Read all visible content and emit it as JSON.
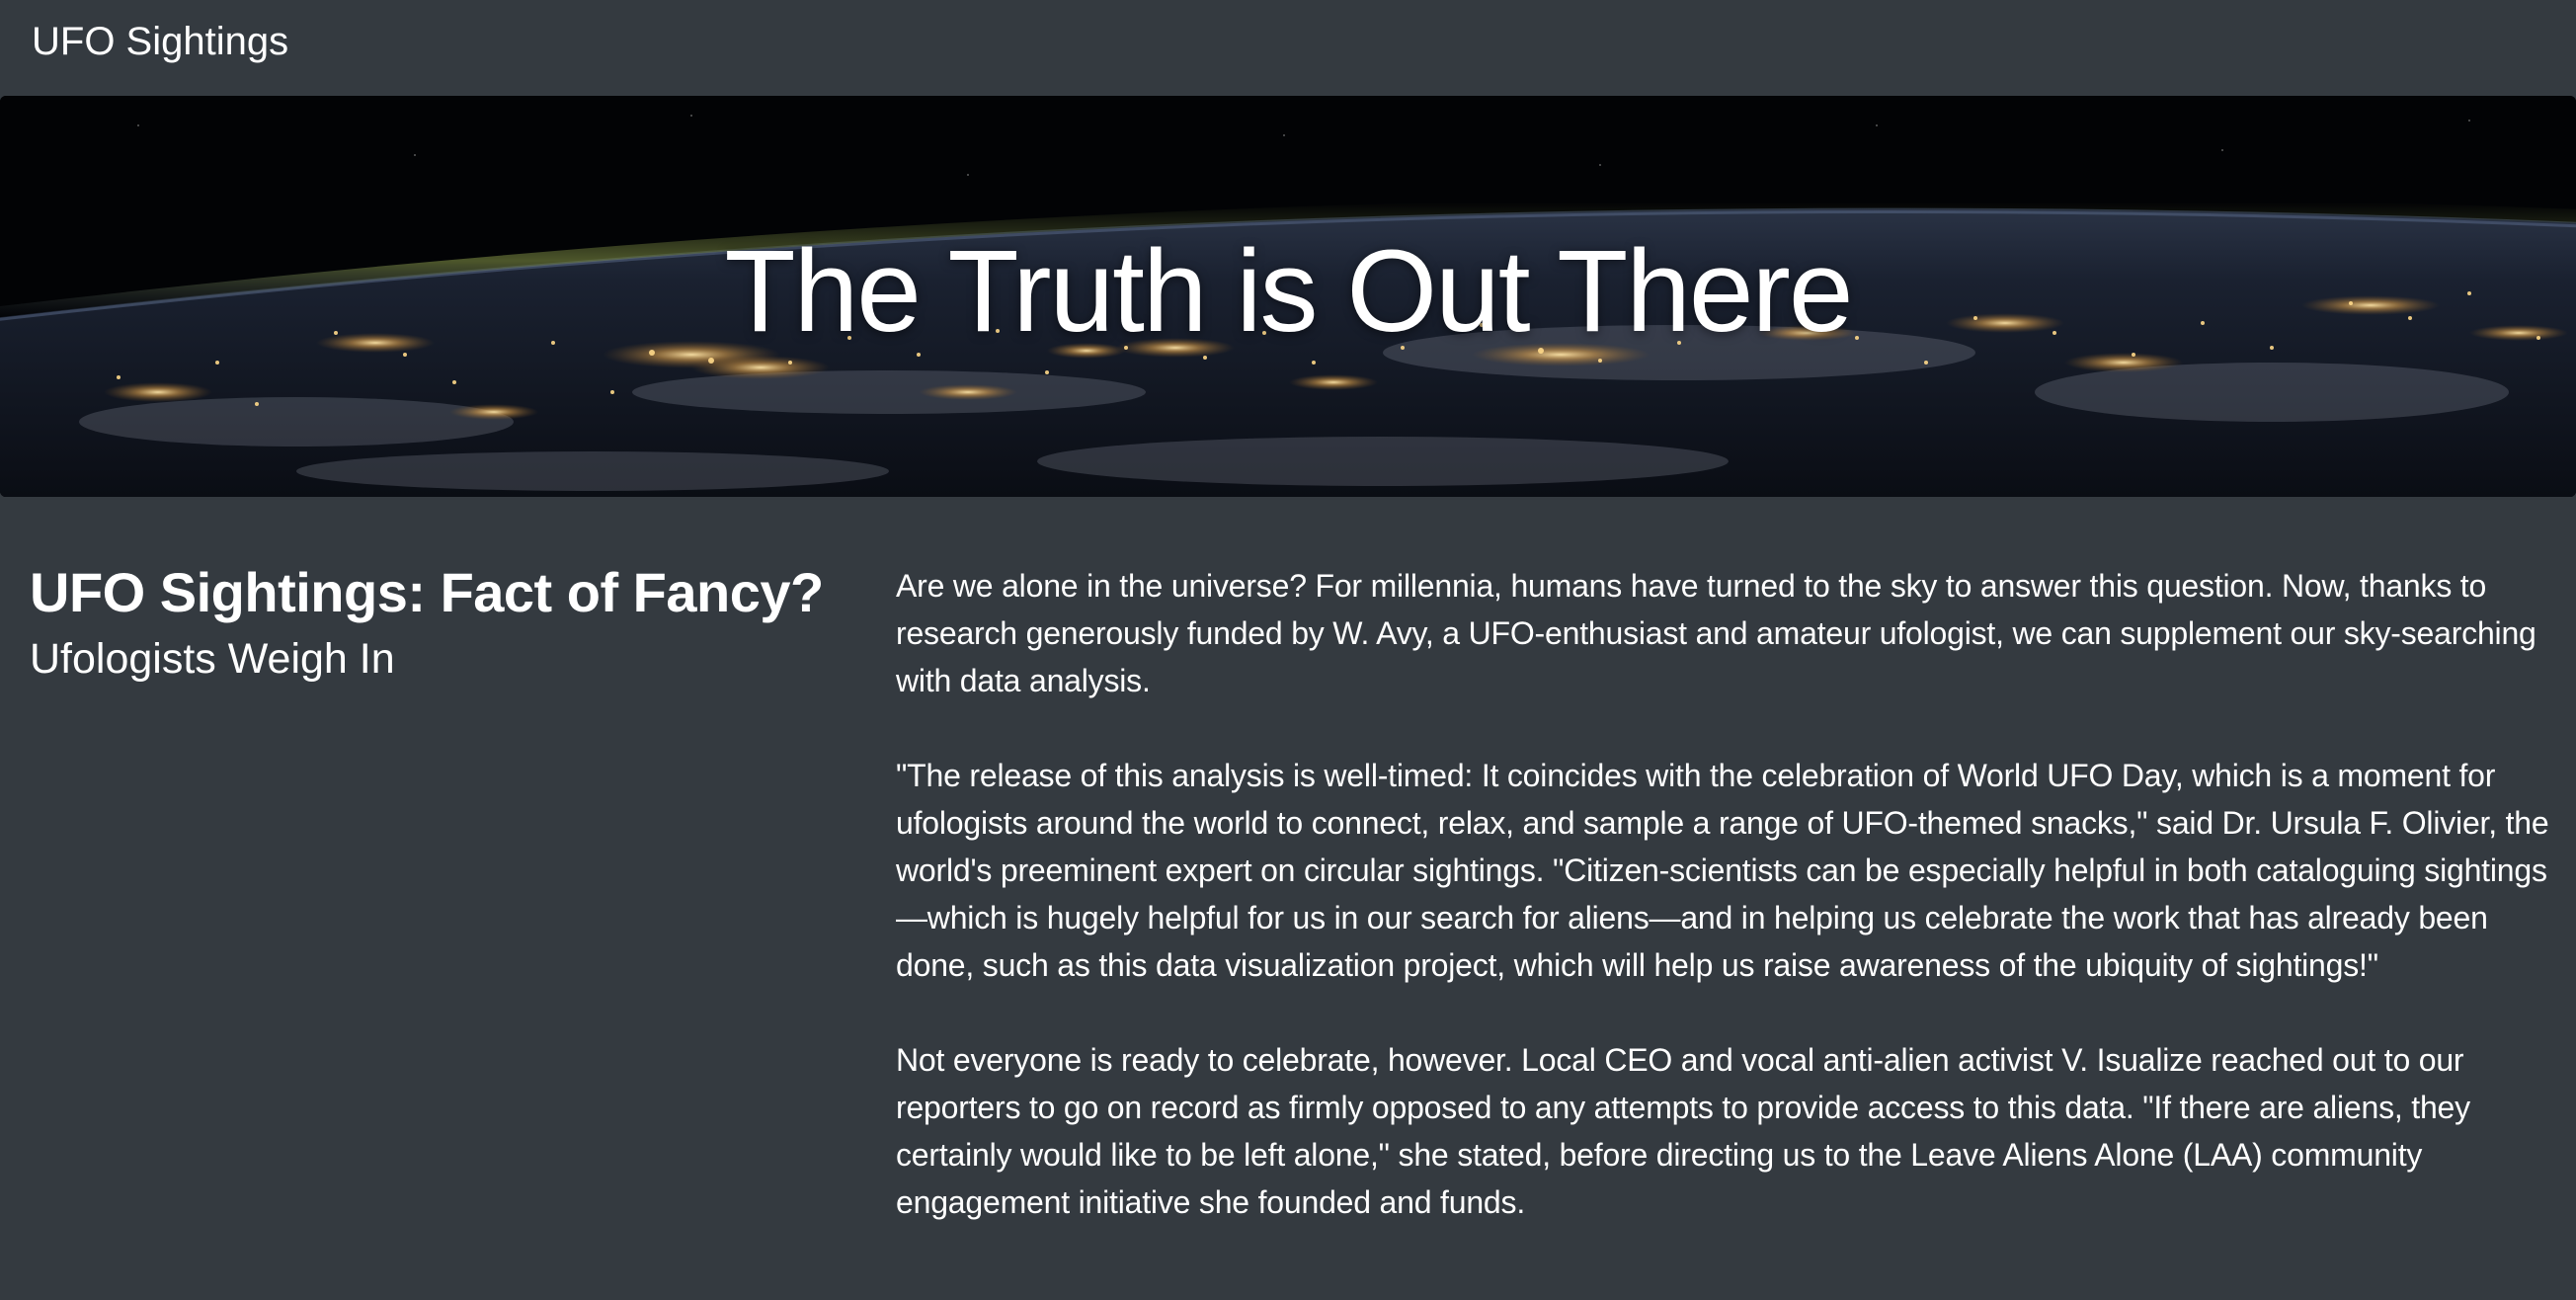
{
  "navbar": {
    "brand": "UFO Sightings"
  },
  "hero": {
    "title": "The Truth is Out There"
  },
  "article": {
    "heading": "UFO Sightings: Fact of Fancy?",
    "subheading": "Ufologists Weigh In",
    "paragraphs": [
      "Are we alone in the universe? For millennia, humans have turned to the sky to answer this question. Now, thanks to research generously funded by W. Avy, a UFO-enthusiast and amateur ufologist, we can supplement our sky-searching with data analysis.",
      "\"The release of this analysis is well-timed: It coincides with the celebration of World UFO Day, which is a moment for ufologists around the world to connect, relax, and sample a range of UFO-themed snacks,\" said Dr. Ursula F. Olivier, the world's preeminent expert on circular sightings. \"Citizen-scientists can be especially helpful in both cataloguing sightings—which is hugely helpful for us in our search for aliens—and in helping us celebrate the work that has already been done, such as this data visualization project, which will help us raise awareness of the ubiquity of sightings!\"",
      "Not everyone is ready to celebrate, however. Local CEO and vocal anti-alien activist V. Isualize reached out to our reporters to go on record as firmly opposed to any attempts to provide access to this data. \"If there are aliens, they certainly would like to be left alone,\" she stated, before directing us to the Leave Aliens Alone (LAA) community engagement initiative she founded and funds."
    ]
  },
  "colors": {
    "background": "#343a40",
    "text": "#ffffff"
  }
}
